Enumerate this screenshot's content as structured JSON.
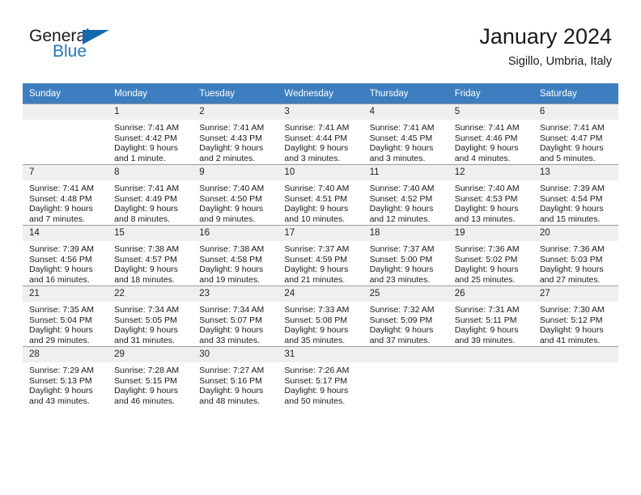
{
  "brand": {
    "name_part1": "General",
    "name_part2": "Blue",
    "triangle_color": "#1469ad",
    "blue_color": "#2077b4"
  },
  "header": {
    "title": "January 2024",
    "subtitle": "Sigillo, Umbria, Italy"
  },
  "calendar": {
    "header_bg": "#3c7ebf",
    "daynum_bg": "#efefef",
    "weekday_headers": [
      "Sunday",
      "Monday",
      "Tuesday",
      "Wednesday",
      "Thursday",
      "Friday",
      "Saturday"
    ],
    "weeks": [
      [
        {
          "day": "",
          "sunrise": "",
          "sunset": "",
          "daylight1": "",
          "daylight2": ""
        },
        {
          "day": "1",
          "sunrise": "Sunrise: 7:41 AM",
          "sunset": "Sunset: 4:42 PM",
          "daylight1": "Daylight: 9 hours",
          "daylight2": "and 1 minute."
        },
        {
          "day": "2",
          "sunrise": "Sunrise: 7:41 AM",
          "sunset": "Sunset: 4:43 PM",
          "daylight1": "Daylight: 9 hours",
          "daylight2": "and 2 minutes."
        },
        {
          "day": "3",
          "sunrise": "Sunrise: 7:41 AM",
          "sunset": "Sunset: 4:44 PM",
          "daylight1": "Daylight: 9 hours",
          "daylight2": "and 3 minutes."
        },
        {
          "day": "4",
          "sunrise": "Sunrise: 7:41 AM",
          "sunset": "Sunset: 4:45 PM",
          "daylight1": "Daylight: 9 hours",
          "daylight2": "and 3 minutes."
        },
        {
          "day": "5",
          "sunrise": "Sunrise: 7:41 AM",
          "sunset": "Sunset: 4:46 PM",
          "daylight1": "Daylight: 9 hours",
          "daylight2": "and 4 minutes."
        },
        {
          "day": "6",
          "sunrise": "Sunrise: 7:41 AM",
          "sunset": "Sunset: 4:47 PM",
          "daylight1": "Daylight: 9 hours",
          "daylight2": "and 5 minutes."
        }
      ],
      [
        {
          "day": "7",
          "sunrise": "Sunrise: 7:41 AM",
          "sunset": "Sunset: 4:48 PM",
          "daylight1": "Daylight: 9 hours",
          "daylight2": "and 7 minutes."
        },
        {
          "day": "8",
          "sunrise": "Sunrise: 7:41 AM",
          "sunset": "Sunset: 4:49 PM",
          "daylight1": "Daylight: 9 hours",
          "daylight2": "and 8 minutes."
        },
        {
          "day": "9",
          "sunrise": "Sunrise: 7:40 AM",
          "sunset": "Sunset: 4:50 PM",
          "daylight1": "Daylight: 9 hours",
          "daylight2": "and 9 minutes."
        },
        {
          "day": "10",
          "sunrise": "Sunrise: 7:40 AM",
          "sunset": "Sunset: 4:51 PM",
          "daylight1": "Daylight: 9 hours",
          "daylight2": "and 10 minutes."
        },
        {
          "day": "11",
          "sunrise": "Sunrise: 7:40 AM",
          "sunset": "Sunset: 4:52 PM",
          "daylight1": "Daylight: 9 hours",
          "daylight2": "and 12 minutes."
        },
        {
          "day": "12",
          "sunrise": "Sunrise: 7:40 AM",
          "sunset": "Sunset: 4:53 PM",
          "daylight1": "Daylight: 9 hours",
          "daylight2": "and 13 minutes."
        },
        {
          "day": "13",
          "sunrise": "Sunrise: 7:39 AM",
          "sunset": "Sunset: 4:54 PM",
          "daylight1": "Daylight: 9 hours",
          "daylight2": "and 15 minutes."
        }
      ],
      [
        {
          "day": "14",
          "sunrise": "Sunrise: 7:39 AM",
          "sunset": "Sunset: 4:56 PM",
          "daylight1": "Daylight: 9 hours",
          "daylight2": "and 16 minutes."
        },
        {
          "day": "15",
          "sunrise": "Sunrise: 7:38 AM",
          "sunset": "Sunset: 4:57 PM",
          "daylight1": "Daylight: 9 hours",
          "daylight2": "and 18 minutes."
        },
        {
          "day": "16",
          "sunrise": "Sunrise: 7:38 AM",
          "sunset": "Sunset: 4:58 PM",
          "daylight1": "Daylight: 9 hours",
          "daylight2": "and 19 minutes."
        },
        {
          "day": "17",
          "sunrise": "Sunrise: 7:37 AM",
          "sunset": "Sunset: 4:59 PM",
          "daylight1": "Daylight: 9 hours",
          "daylight2": "and 21 minutes."
        },
        {
          "day": "18",
          "sunrise": "Sunrise: 7:37 AM",
          "sunset": "Sunset: 5:00 PM",
          "daylight1": "Daylight: 9 hours",
          "daylight2": "and 23 minutes."
        },
        {
          "day": "19",
          "sunrise": "Sunrise: 7:36 AM",
          "sunset": "Sunset: 5:02 PM",
          "daylight1": "Daylight: 9 hours",
          "daylight2": "and 25 minutes."
        },
        {
          "day": "20",
          "sunrise": "Sunrise: 7:36 AM",
          "sunset": "Sunset: 5:03 PM",
          "daylight1": "Daylight: 9 hours",
          "daylight2": "and 27 minutes."
        }
      ],
      [
        {
          "day": "21",
          "sunrise": "Sunrise: 7:35 AM",
          "sunset": "Sunset: 5:04 PM",
          "daylight1": "Daylight: 9 hours",
          "daylight2": "and 29 minutes."
        },
        {
          "day": "22",
          "sunrise": "Sunrise: 7:34 AM",
          "sunset": "Sunset: 5:05 PM",
          "daylight1": "Daylight: 9 hours",
          "daylight2": "and 31 minutes."
        },
        {
          "day": "23",
          "sunrise": "Sunrise: 7:34 AM",
          "sunset": "Sunset: 5:07 PM",
          "daylight1": "Daylight: 9 hours",
          "daylight2": "and 33 minutes."
        },
        {
          "day": "24",
          "sunrise": "Sunrise: 7:33 AM",
          "sunset": "Sunset: 5:08 PM",
          "daylight1": "Daylight: 9 hours",
          "daylight2": "and 35 minutes."
        },
        {
          "day": "25",
          "sunrise": "Sunrise: 7:32 AM",
          "sunset": "Sunset: 5:09 PM",
          "daylight1": "Daylight: 9 hours",
          "daylight2": "and 37 minutes."
        },
        {
          "day": "26",
          "sunrise": "Sunrise: 7:31 AM",
          "sunset": "Sunset: 5:11 PM",
          "daylight1": "Daylight: 9 hours",
          "daylight2": "and 39 minutes."
        },
        {
          "day": "27",
          "sunrise": "Sunrise: 7:30 AM",
          "sunset": "Sunset: 5:12 PM",
          "daylight1": "Daylight: 9 hours",
          "daylight2": "and 41 minutes."
        }
      ],
      [
        {
          "day": "28",
          "sunrise": "Sunrise: 7:29 AM",
          "sunset": "Sunset: 5:13 PM",
          "daylight1": "Daylight: 9 hours",
          "daylight2": "and 43 minutes."
        },
        {
          "day": "29",
          "sunrise": "Sunrise: 7:28 AM",
          "sunset": "Sunset: 5:15 PM",
          "daylight1": "Daylight: 9 hours",
          "daylight2": "and 46 minutes."
        },
        {
          "day": "30",
          "sunrise": "Sunrise: 7:27 AM",
          "sunset": "Sunset: 5:16 PM",
          "daylight1": "Daylight: 9 hours",
          "daylight2": "and 48 minutes."
        },
        {
          "day": "31",
          "sunrise": "Sunrise: 7:26 AM",
          "sunset": "Sunset: 5:17 PM",
          "daylight1": "Daylight: 9 hours",
          "daylight2": "and 50 minutes."
        },
        {
          "day": "",
          "sunrise": "",
          "sunset": "",
          "daylight1": "",
          "daylight2": ""
        },
        {
          "day": "",
          "sunrise": "",
          "sunset": "",
          "daylight1": "",
          "daylight2": ""
        },
        {
          "day": "",
          "sunrise": "",
          "sunset": "",
          "daylight1": "",
          "daylight2": ""
        }
      ]
    ]
  }
}
